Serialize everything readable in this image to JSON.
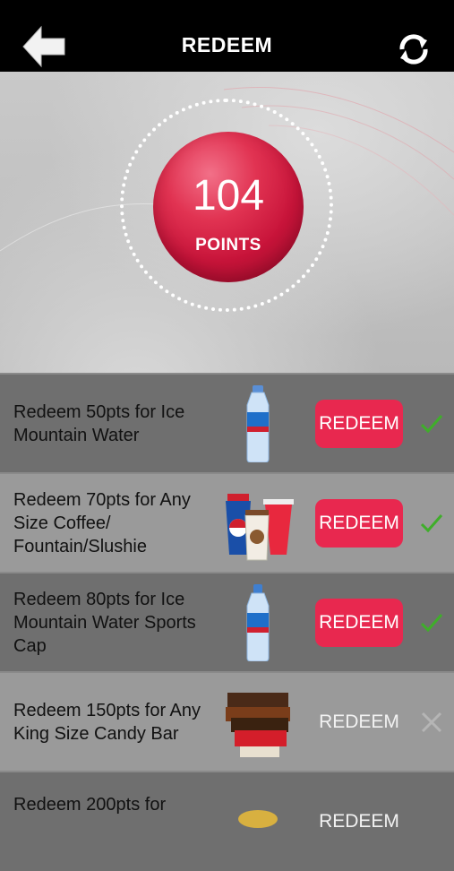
{
  "header": {
    "title": "REDEEM",
    "back_icon": "back-arrow-icon",
    "refresh_icon": "refresh-icon"
  },
  "points": {
    "value": "104",
    "label": "POINTS"
  },
  "colors": {
    "accent": "#e8284f",
    "check": "#3fae2a",
    "row_dark": "#6f6f6f",
    "row_light": "#9a9a9a"
  },
  "rewards": [
    {
      "text": "Redeem 50pts for Ice Mountain Water",
      "button": "REDEEM",
      "available": true,
      "image": "water-bottle-image",
      "status_icon": "checkmark-icon"
    },
    {
      "text": "Redeem 70pts for Any Size Coffee/ Fountain/Slushie",
      "button": "REDEEM",
      "available": true,
      "image": "drinks-image",
      "status_icon": "checkmark-icon"
    },
    {
      "text": "Redeem 80pts for Ice Mountain Water Sports Cap",
      "button": "REDEEM",
      "available": true,
      "image": "sports-cap-bottle-image",
      "status_icon": "checkmark-icon"
    },
    {
      "text": "Redeem 150pts for Any King Size Candy Bar",
      "button": "REDEEM",
      "available": false,
      "image": "candy-bars-image",
      "status_icon": "x-icon"
    },
    {
      "text": "Redeem 200pts for",
      "button": "REDEEM",
      "available": false,
      "image": "snack-image",
      "status_icon": "x-icon"
    }
  ]
}
